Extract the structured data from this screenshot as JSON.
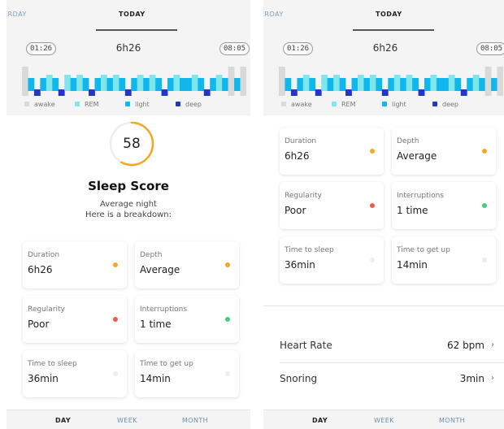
{
  "tabs": {
    "previous_partial": "ERDAY",
    "current": "TODAY"
  },
  "hypnogram": {
    "start_time": "01:26",
    "end_time": "08:05",
    "total_duration": "6h26",
    "legend": [
      {
        "label": "awake",
        "color": "#d9d9d9"
      },
      {
        "label": "REM",
        "color": "#7fe6ec"
      },
      {
        "label": "light",
        "color": "#11b7ec"
      },
      {
        "label": "deep",
        "color": "#2236c7"
      }
    ],
    "stages_sequence": [
      "awake",
      "light",
      "deep",
      "light",
      "REM",
      "light",
      "deep",
      "REM",
      "light",
      "REM",
      "light",
      "deep",
      "light",
      "REM",
      "light",
      "REM",
      "light",
      "deep",
      "light",
      "REM",
      "light",
      "REM",
      "light",
      "deep",
      "light",
      "REM",
      "light",
      "light",
      "REM",
      "light",
      "deep",
      "light",
      "REM",
      "light",
      "awake",
      "light",
      "awake"
    ]
  },
  "sleep_score": {
    "value": "58",
    "value_fraction": 0.58,
    "title": "Sleep Score",
    "subtitle_line1": "Average night",
    "subtitle_line2": "Here is a breakdown:",
    "ring_color": "#f5a623"
  },
  "metrics": [
    {
      "label": "Duration",
      "value": "6h26",
      "status_color": "#f5a623"
    },
    {
      "label": "Depth",
      "value": "Average",
      "status_color": "#f5a623"
    },
    {
      "label": "Regularity",
      "value": "Poor",
      "status_color": "#ec5b4c"
    },
    {
      "label": "Interruptions",
      "value": "1 time",
      "status_color": "#3fcf7f"
    },
    {
      "label": "Time to sleep",
      "value": "36min",
      "status_color": "#eeeeee"
    },
    {
      "label": "Time to get up",
      "value": "14min",
      "status_color": "#eeeeee"
    }
  ],
  "vitals": [
    {
      "label": "Heart Rate",
      "value": "62 bpm"
    },
    {
      "label": "Snoring",
      "value": "3min"
    }
  ],
  "bottom_nav": {
    "day": "DAY",
    "week": "WEEK",
    "month": "MONTH"
  }
}
